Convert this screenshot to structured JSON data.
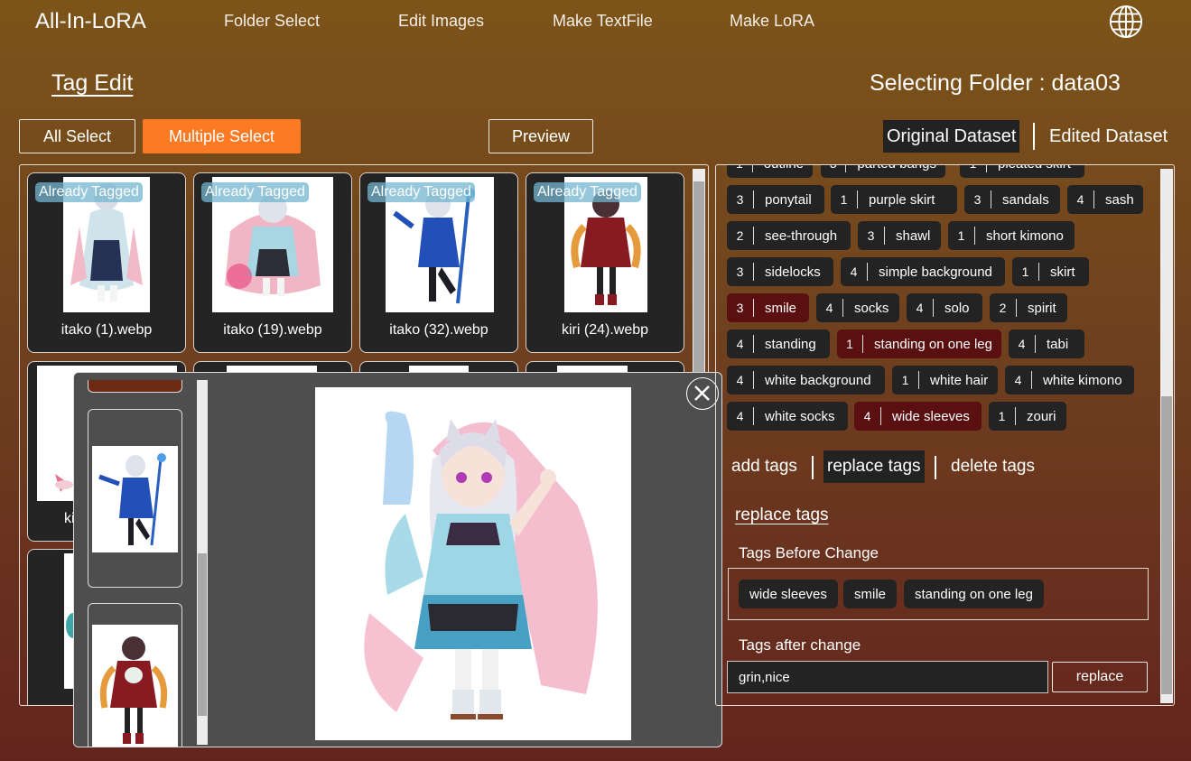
{
  "app": {
    "title": "All-In-LoRA",
    "nav": [
      "Folder Select",
      "Edit Images",
      "Make TextFile",
      "Make LoRA"
    ],
    "language_icon": "globe-icon"
  },
  "page": {
    "section_title": "Tag Edit",
    "folder_label": "Selecting Folder : data03"
  },
  "toolbar": {
    "all_select": "All Select",
    "multiple_select": "Multiple Select",
    "preview": "Preview"
  },
  "dataset_tabs": {
    "original": "Original Dataset",
    "edited": "Edited Dataset",
    "selected": "original"
  },
  "grid": {
    "badge": "Already Tagged",
    "cards": [
      {
        "file": "itako (1).webp"
      },
      {
        "file": "itako (19).webp"
      },
      {
        "file": "itako (32).webp"
      },
      {
        "file": "kiri (24).webp"
      }
    ],
    "partial_label": "ki"
  },
  "tags": [
    {
      "count": "1",
      "name": "outline",
      "highlight": false
    },
    {
      "count": "3",
      "name": "parted bangs",
      "highlight": false
    },
    {
      "count": "1",
      "name": "pleated skirt",
      "highlight": false
    },
    {
      "count": "3",
      "name": "ponytail",
      "highlight": false
    },
    {
      "count": "1",
      "name": "purple skirt",
      "highlight": false
    },
    {
      "count": "3",
      "name": "sandals",
      "highlight": false
    },
    {
      "count": "4",
      "name": "sash",
      "highlight": false
    },
    {
      "count": "2",
      "name": "see-through",
      "highlight": false
    },
    {
      "count": "3",
      "name": "shawl",
      "highlight": false
    },
    {
      "count": "1",
      "name": "short kimono",
      "highlight": false
    },
    {
      "count": "3",
      "name": "sidelocks",
      "highlight": false
    },
    {
      "count": "4",
      "name": "simple background",
      "highlight": false
    },
    {
      "count": "1",
      "name": "skirt",
      "highlight": false
    },
    {
      "count": "3",
      "name": "smile",
      "highlight": true
    },
    {
      "count": "4",
      "name": "socks",
      "highlight": false
    },
    {
      "count": "4",
      "name": "solo",
      "highlight": false
    },
    {
      "count": "2",
      "name": "spirit",
      "highlight": false
    },
    {
      "count": "4",
      "name": "standing",
      "highlight": false
    },
    {
      "count": "1",
      "name": "standing on one leg",
      "highlight": true
    },
    {
      "count": "4",
      "name": "tabi",
      "highlight": false
    },
    {
      "count": "4",
      "name": "white background",
      "highlight": false
    },
    {
      "count": "1",
      "name": "white hair",
      "highlight": false
    },
    {
      "count": "4",
      "name": "white kimono",
      "highlight": false
    },
    {
      "count": "4",
      "name": "white socks",
      "highlight": false
    },
    {
      "count": "4",
      "name": "wide sleeves",
      "highlight": true
    },
    {
      "count": "1",
      "name": "zouri",
      "highlight": false
    }
  ],
  "tag_ops": {
    "add": "add tags",
    "replace": "replace tags",
    "delete": "delete tags",
    "selected": "replace"
  },
  "replace_form": {
    "heading": "replace tags",
    "before_label": "Tags Before Change",
    "before_tags": [
      "wide sleeves",
      "smile",
      "standing on one leg"
    ],
    "after_label": "Tags after change",
    "after_value": "grin,nice",
    "submit_label": "replace"
  },
  "colors": {
    "accent": "#fb7a23",
    "highlight_tag": "#5a1010",
    "dark_surface": "#232323",
    "badge": "#73b4cd"
  }
}
